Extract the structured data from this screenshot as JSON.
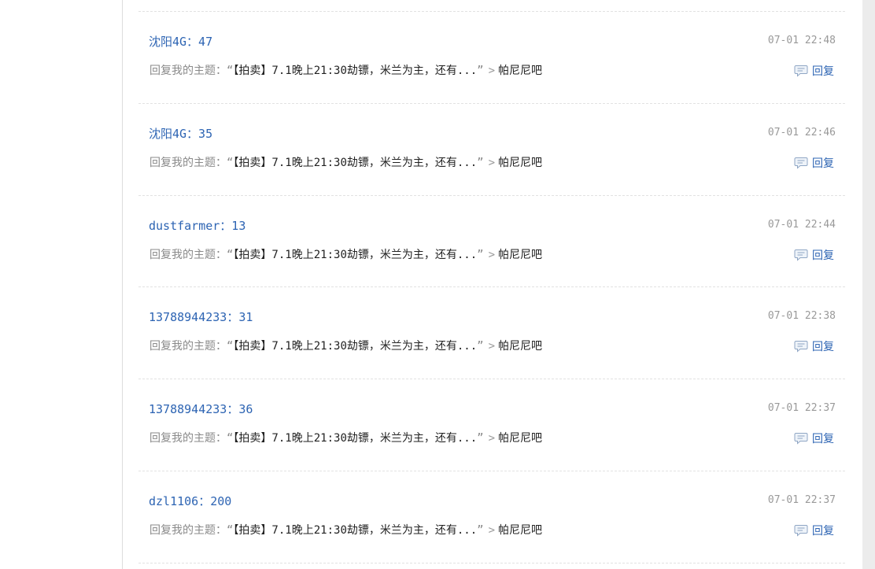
{
  "theme": {
    "link": "#2d64b3",
    "muted": "#8a8a8a",
    "text": "#222222",
    "divider": "#e2e2e2"
  },
  "feed": {
    "items": [
      {
        "sender": "沈阳4G：47",
        "time": "07-01 22:48",
        "prefix": "回复我的主题：",
        "quote_open": "“",
        "topic": "【拍卖】7.1晚上21:30劫镖，米兰为主，还有...",
        "quote_close": "”",
        "separator": ">",
        "forum": "帕尼尼吧",
        "reply_label": "回复",
        "reply_icon": "speech-bubble-icon"
      },
      {
        "sender": "沈阳4G：35",
        "time": "07-01 22:46",
        "prefix": "回复我的主题：",
        "quote_open": "“",
        "topic": "【拍卖】7.1晚上21:30劫镖，米兰为主，还有...",
        "quote_close": "”",
        "separator": ">",
        "forum": "帕尼尼吧",
        "reply_label": "回复",
        "reply_icon": "speech-bubble-icon"
      },
      {
        "sender": "dustfarmer：13",
        "time": "07-01 22:44",
        "prefix": "回复我的主题：",
        "quote_open": "“",
        "topic": "【拍卖】7.1晚上21:30劫镖，米兰为主，还有...",
        "quote_close": "”",
        "separator": ">",
        "forum": "帕尼尼吧",
        "reply_label": "回复",
        "reply_icon": "speech-bubble-icon"
      },
      {
        "sender": "13788944233：31",
        "time": "07-01 22:38",
        "prefix": "回复我的主题：",
        "quote_open": "“",
        "topic": "【拍卖】7.1晚上21:30劫镖，米兰为主，还有...",
        "quote_close": "”",
        "separator": ">",
        "forum": "帕尼尼吧",
        "reply_label": "回复",
        "reply_icon": "speech-bubble-icon"
      },
      {
        "sender": "13788944233：36",
        "time": "07-01 22:37",
        "prefix": "回复我的主题：",
        "quote_open": "“",
        "topic": "【拍卖】7.1晚上21:30劫镖，米兰为主，还有...",
        "quote_close": "”",
        "separator": ">",
        "forum": "帕尼尼吧",
        "reply_label": "回复",
        "reply_icon": "speech-bubble-icon"
      },
      {
        "sender": "dzl1106：200",
        "time": "07-01 22:37",
        "prefix": "回复我的主题：",
        "quote_open": "“",
        "topic": "【拍卖】7.1晚上21:30劫镖，米兰为主，还有...",
        "quote_close": "”",
        "separator": ">",
        "forum": "帕尼尼吧",
        "reply_label": "回复",
        "reply_icon": "speech-bubble-icon"
      }
    ]
  }
}
